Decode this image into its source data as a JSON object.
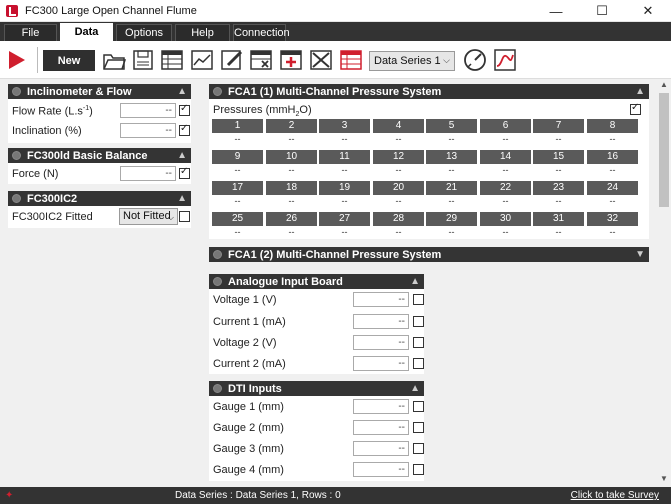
{
  "window": {
    "title": "FC300 Large Open Channel Flume",
    "minimize": "—",
    "maximize": "☐",
    "close": "✕"
  },
  "menu": {
    "tabs": [
      "File",
      "Data",
      "Options",
      "Help",
      "Connection"
    ],
    "active": "Data"
  },
  "toolbar": {
    "new_label": "New",
    "series_select": "Data Series 1",
    "icons": [
      "run-icon",
      "open-folder-icon",
      "save-icon",
      "table-icon",
      "chart-icon",
      "edit-icon",
      "delete-row-icon",
      "add-row-icon",
      "clear-icon",
      "table-red-icon",
      "gauge-icon",
      "plot-icon"
    ]
  },
  "inclinometer": {
    "title": "Inclinometer & Flow",
    "flow_rate_label": "Flow Rate (L.s",
    "flow_rate_sup": "-1",
    "flow_rate_close": ")",
    "flow_rate_value": "--",
    "inclination_label": "Inclination  (%)",
    "inclination_value": "--"
  },
  "balance": {
    "title": "FC300ld Basic Balance",
    "force_label": "Force  (N)",
    "force_value": "--"
  },
  "ic2": {
    "title": "FC300IC2",
    "fitted_label": "FC300IC2 Fitted",
    "fitted_value": "Not Fitted"
  },
  "fca1": {
    "title": "FCA1 (1) Multi-Channel Pressure System",
    "pressures_label": "Pressures (mmH",
    "pressures_sub": "2",
    "pressures_close": "O)",
    "channels": [
      "1",
      "2",
      "3",
      "4",
      "5",
      "6",
      "7",
      "8",
      "9",
      "10",
      "11",
      "12",
      "13",
      "14",
      "15",
      "16",
      "17",
      "18",
      "19",
      "20",
      "21",
      "22",
      "23",
      "24",
      "25",
      "26",
      "27",
      "28",
      "29",
      "30",
      "31",
      "32"
    ],
    "value": "--"
  },
  "fca2": {
    "title": "FCA1 (2) Multi-Channel Pressure System"
  },
  "analogue": {
    "title": "Analogue Input Board",
    "fields": [
      {
        "label": "Voltage 1 (V)",
        "value": "--"
      },
      {
        "label": "Current 1 (mA)",
        "value": "--"
      },
      {
        "label": "Voltage 2 (V)",
        "value": "--"
      },
      {
        "label": "Current 2 (mA)",
        "value": "--"
      }
    ]
  },
  "dti": {
    "title": "DTI Inputs",
    "fields": [
      {
        "label": "Gauge 1 (mm)",
        "value": "--"
      },
      {
        "label": "Gauge 2 (mm)",
        "value": "--"
      },
      {
        "label": "Gauge 3 (mm)",
        "value": "--"
      },
      {
        "label": "Gauge 4 (mm)",
        "value": "--"
      }
    ]
  },
  "status": {
    "text": "Data Series : Data Series 1,  Rows : 0",
    "survey_link": "Click to take Survey"
  },
  "colors": {
    "accent": "#d01f2e",
    "panel_header": "#343434",
    "channel_header": "#5a5a5a"
  }
}
